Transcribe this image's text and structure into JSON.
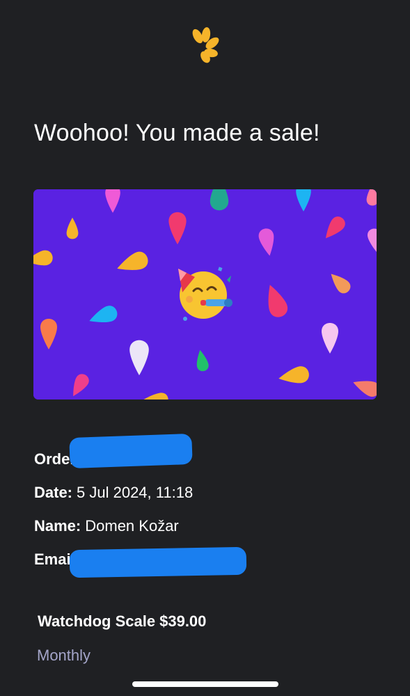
{
  "brand": {
    "logo_icon": "petal-fan-logo-icon",
    "logo_color": "#f6b42a"
  },
  "headline": "Woohoo! You made a sale!",
  "banner": {
    "background_color": "#5a22e2",
    "emoji": "🥳",
    "emoji_name": "partying-face-icon"
  },
  "order": {
    "order_label": "Order #",
    "order_value": "",
    "date_label": "Date:",
    "date_value": "5 Jul 2024, 11:18",
    "name_label": "Name:",
    "name_value": "Domen Kožar",
    "email_label": "Email",
    "email_value": ""
  },
  "product": {
    "name": "Watchdog Scale",
    "price": "$39.00",
    "billing_period": "Monthly"
  },
  "colors": {
    "background": "#1f2023",
    "text": "#ffffff",
    "muted": "#a4a5c9",
    "redaction": "#1a7ff0"
  }
}
